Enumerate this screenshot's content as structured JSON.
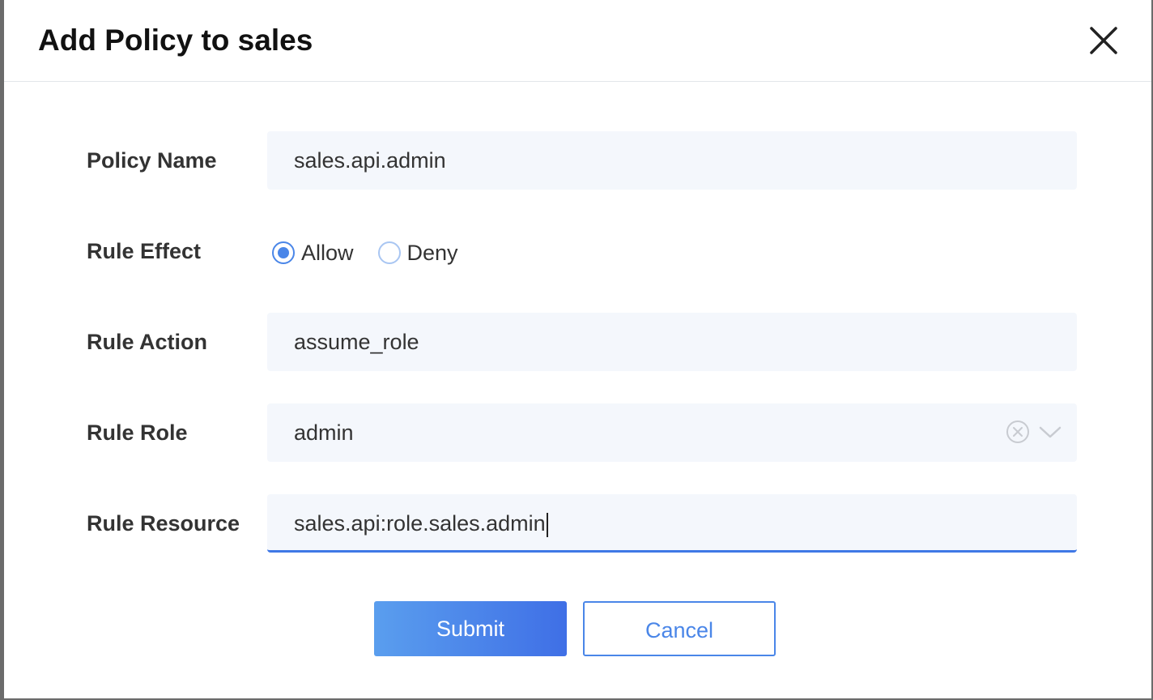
{
  "dialog": {
    "title": "Add Policy to sales"
  },
  "form": {
    "policy_name": {
      "label": "Policy Name",
      "value": "sales.api.admin"
    },
    "rule_effect": {
      "label": "Rule Effect",
      "options": [
        "Allow",
        "Deny"
      ],
      "selected": "Allow"
    },
    "rule_action": {
      "label": "Rule Action",
      "value": "assume_role"
    },
    "rule_role": {
      "label": "Rule Role",
      "value": "admin"
    },
    "rule_resource": {
      "label": "Rule Resource",
      "value": "sales.api:role.sales.admin"
    }
  },
  "buttons": {
    "submit": "Submit",
    "cancel": "Cancel"
  },
  "colors": {
    "accent": "#4a86e8",
    "field_bg": "#f4f7fc",
    "focus_border": "#3f78e6"
  },
  "icons": {
    "close": "close-icon",
    "clear": "clear-circle-icon",
    "dropdown": "chevron-down-icon"
  }
}
